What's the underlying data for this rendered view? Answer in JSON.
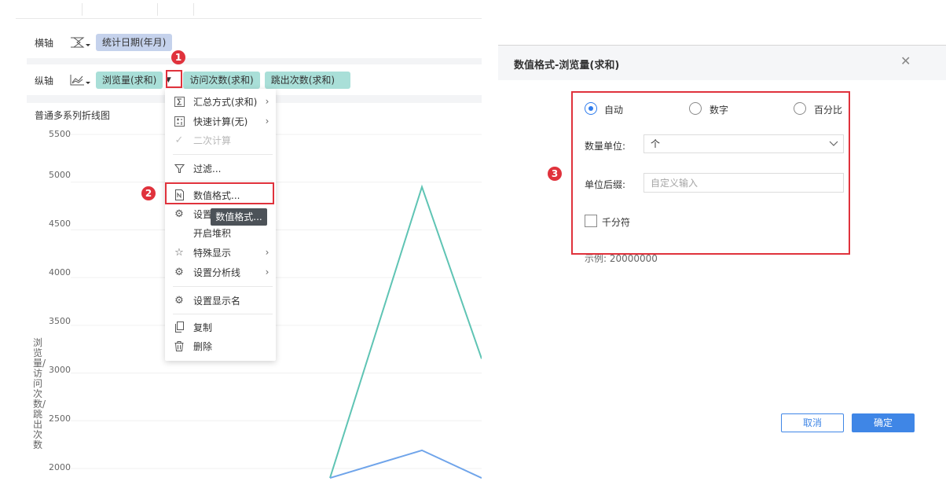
{
  "editor": {
    "x_axis": {
      "label": "横轴",
      "field": "统计日期(年月)"
    },
    "y_axis": {
      "label": "纵轴",
      "fields": [
        "浏览量(求和)",
        "访问次数(求和)",
        "跳出次数(求和)"
      ]
    }
  },
  "chart": {
    "title": "普通多系列折线图",
    "y_axis_label": "浏览量/访问次数/跳出次数",
    "y_ticks": [
      "5500",
      "5000",
      "4500",
      "4000",
      "3500",
      "3000",
      "2500",
      "2000"
    ]
  },
  "chart_data": {
    "type": "line",
    "title": "普通多系列折线图",
    "ylabel": "浏览量/访问次数/跳出次数",
    "ylim": [
      2000,
      5500
    ],
    "series": [
      {
        "values": [
          1900,
          4950,
          3150
        ],
        "color": "#5fc4b4"
      },
      {
        "values": [
          1900,
          2190,
          1900
        ],
        "color": "#6fa4ea"
      }
    ]
  },
  "menu": {
    "items": [
      {
        "icon": "sigma-icon",
        "label": "汇总方式(求和)",
        "submenu": true
      },
      {
        "icon": "calculator-icon",
        "label": "快速计算(无)",
        "submenu": true
      },
      {
        "icon": "check-icon",
        "label": "二次计算",
        "disabled": true
      },
      {
        "icon": "filter-icon",
        "label": "过滤..."
      },
      {
        "icon": "number-format-icon",
        "label": "数值格式..."
      },
      {
        "icon": "gear-icon",
        "label": "设置"
      },
      {
        "icon": "",
        "label": "开启堆积"
      },
      {
        "icon": "star-icon",
        "label": "特殊显示",
        "submenu": true
      },
      {
        "icon": "gear-icon",
        "label": "设置分析线",
        "submenu": true
      },
      {
        "icon": "gear-icon",
        "label": "设置显示名"
      },
      {
        "icon": "copy-icon",
        "label": "复制"
      },
      {
        "icon": "trash-icon",
        "label": "删除"
      }
    ],
    "tooltip": "数值格式..."
  },
  "badges": [
    "1",
    "2",
    "3"
  ],
  "dialog": {
    "title": "数值格式-浏览量(求和)",
    "radios": [
      {
        "label": "自动",
        "selected": true
      },
      {
        "label": "数字",
        "selected": false
      },
      {
        "label": "百分比",
        "selected": false
      }
    ],
    "unit_label": "数量单位:",
    "unit_value": "个",
    "suffix_label": "单位后缀:",
    "suffix_placeholder": "自定义输入",
    "thousands_label": "千分符",
    "example": "示例: 20000000",
    "cancel": "取消",
    "ok": "确定"
  },
  "colors": {
    "accent": "#2f7ced",
    "highlight": "#e0323c",
    "series1": "#5fc4b4",
    "series2": "#6fa4ea"
  }
}
